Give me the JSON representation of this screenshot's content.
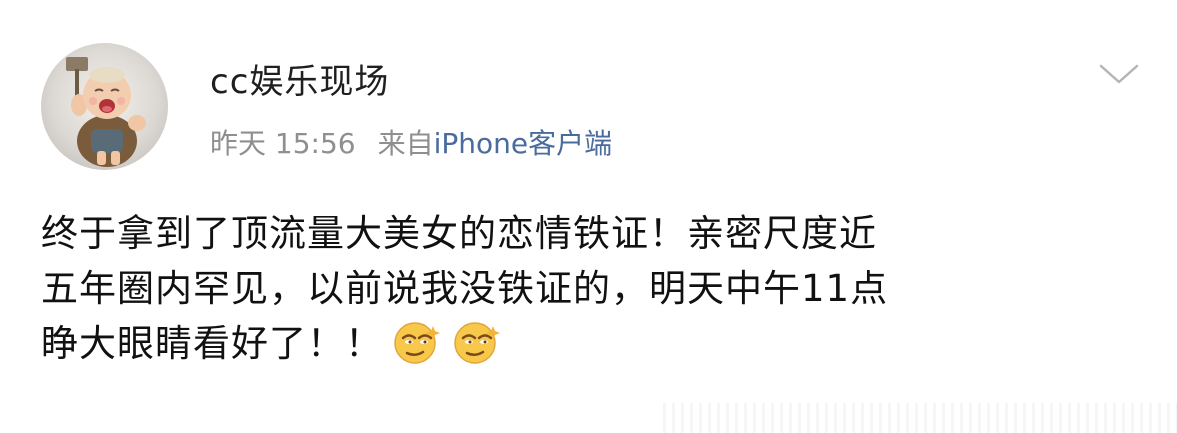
{
  "post": {
    "author_name": "cc娱乐现场",
    "timestamp": "昨天 15:56",
    "source_prefix": "来自",
    "source_name": "iPhone客户端",
    "content_lines": [
      "终于拿到了顶流量大美女的恋情铁证！亲密尺度近",
      "五年圈内罕见，以前说我没铁证的，明天中午11点",
      "睁大眼睛看好了！！"
    ],
    "emojis": [
      "smirk-emoji",
      "smirk-emoji"
    ]
  },
  "icons": {
    "menu": "chevron-down-icon",
    "avatar": "baby-thor-avatar"
  },
  "colors": {
    "text": "#111111",
    "meta": "#8f8f8f",
    "link": "#4a6b9d",
    "emoji": "#f7c84a"
  }
}
